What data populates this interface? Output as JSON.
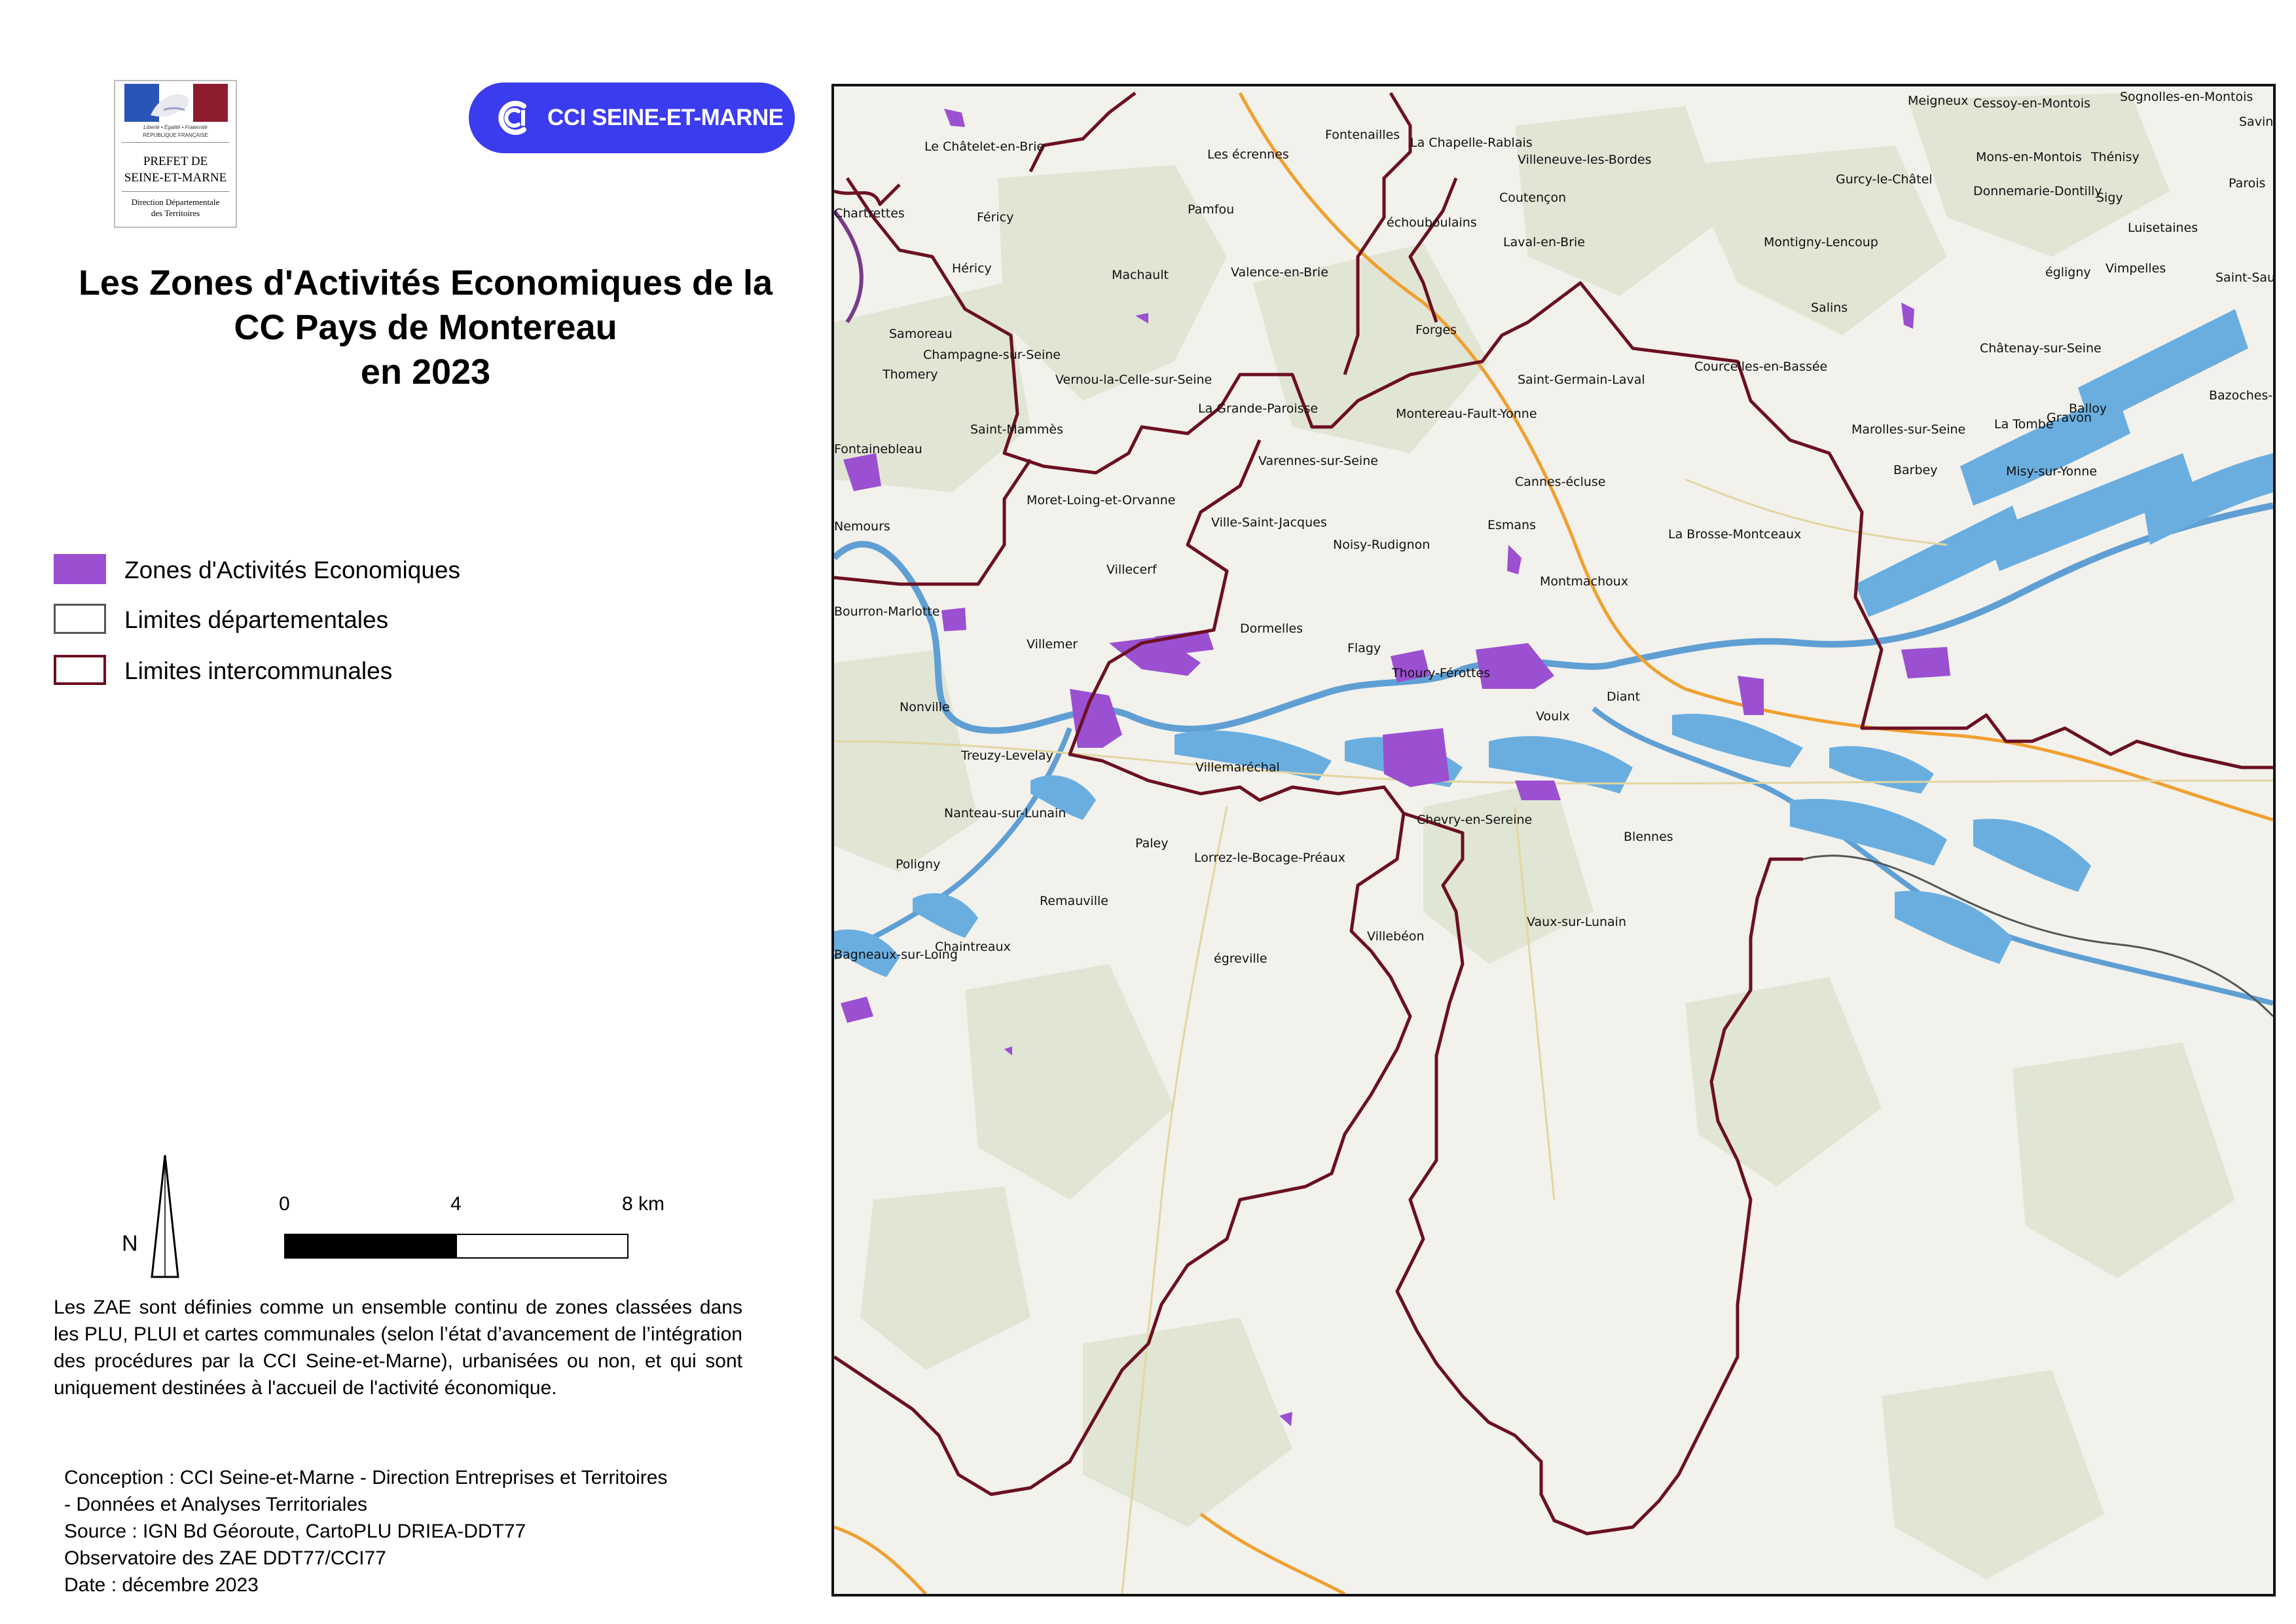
{
  "logo": {
    "motto": "Liberté • Égalité • Fraternité",
    "republic": "RÉPUBLIQUE FRANÇAISE",
    "prefet_lines": [
      "PREFET DE",
      "SEINE-ET-MARNE"
    ],
    "direction_lines": [
      "Direction Départementale",
      "des Territoires"
    ]
  },
  "cci_badge": {
    "label": "CCI SEINE-ET-MARNE"
  },
  "title": {
    "line1": "Les Zones d'Activités Economiques de la",
    "line2": "CC Pays de Montereau",
    "line3": "en 2023"
  },
  "legend": {
    "items": [
      {
        "label": "Zones d'Activités Economiques",
        "color": "#9b4fd1",
        "border": "#9b4fd1"
      },
      {
        "label": "Limites départementales",
        "color": "#ffffff",
        "border": "#555555"
      },
      {
        "label": "Limites intercommunales",
        "color": "#ffffff",
        "border": "#6b1020"
      }
    ]
  },
  "north_arrow": {
    "label": "N"
  },
  "scale": {
    "ticks": [
      "0",
      "4",
      "8 km"
    ]
  },
  "note": "Les ZAE sont définies comme un ensemble continu de zones classées dans les PLU, PLUI et cartes communales (selon l’état d’avancement de l’intégration des procédures par la CCI Seine-et-Marne), urbanisées ou non, et qui sont uniquement destinées à l'accueil de l'activité économique.",
  "credits": {
    "line1": "Conception : CCI Seine-et-Marne - Direction Entreprises et Territoires",
    "line2": "- Données et Analyses Territoriales",
    "line3": "Source : IGN Bd Géoroute, CartoPLU DRIEA-DDT77",
    "line4": "Observatoire des ZAE DDT77/CCI77",
    "line5": "Date : décembre 2023"
  },
  "map": {
    "colors": {
      "zae": "#9b4fd1",
      "water": "#6aaee0",
      "boundary": "#6b1020",
      "road": "#f0a030",
      "background": "#f2f1ec",
      "woods": "#dde3d0"
    },
    "places": [
      "Fontenailles",
      "La Chapelle-Rablais",
      "Meigneux",
      "Cessoy-en-Montois",
      "Sognolles-en-Montois",
      "Savins",
      "Le Châtelet-en-Brie",
      "Les écrennes",
      "Villeneuve-les-Bordes",
      "Mons-en-Montois",
      "Thénisy",
      "Chartrettes",
      "Gurcy-le-Châtel",
      "Parois",
      "Coutençon",
      "Donnemarie-Dontilly",
      "Sigy",
      "Pamfou",
      "Féricy",
      "échouboulains",
      "Laval-en-Brie",
      "Montigny-Lencoup",
      "Luisetaines",
      "Héricy",
      "Machault",
      "Valence-en-Brie",
      "égligny",
      "Vimpelles",
      "Saint-Sauveur",
      "Salins",
      "Samoreau",
      "Forges",
      "Châtenay-sur-Seine",
      "Champagne-sur-Seine",
      "Saint-Germain-Laval",
      "Courcelles-en-Bassée",
      "Thomery",
      "Vernou-la-Celle-sur-Seine",
      "Balloy",
      "Bazoches-lès-Bray",
      "La Grande-Paroisse",
      "Montereau-Fault-Yonne",
      "La Tombe",
      "Gravon",
      "Saint-Mammès",
      "Marolles-sur-Seine",
      "Fontainebleau",
      "Varennes-sur-Seine",
      "Barbey",
      "Misy-sur-Yonne",
      "Cannes-écluse",
      "Moret-Loing-et-Orvanne",
      "Ville-Saint-Jacques",
      "Esmans",
      "Nemours",
      "La Brosse-Montceaux",
      "Noisy-Rudignon",
      "Villecerf",
      "Montmachoux",
      "Bourron-Marlotte",
      "Dormelles",
      "Flagy",
      "Villemer",
      "Thoury-Férottes",
      "Diant",
      "Nonville",
      "Voulx",
      "Treuzy-Levelay",
      "Villemaréchal",
      "Nanteau-sur-Lunain",
      "Chevry-en-Sereine",
      "Paley",
      "Lorrez-le-Bocage-Préaux",
      "Blennes",
      "Poligny",
      "Remauville",
      "Vaux-sur-Lunain",
      "Chaintreaux",
      "Villebéon",
      "Bagneaux-sur-Loing",
      "égreville"
    ]
  }
}
